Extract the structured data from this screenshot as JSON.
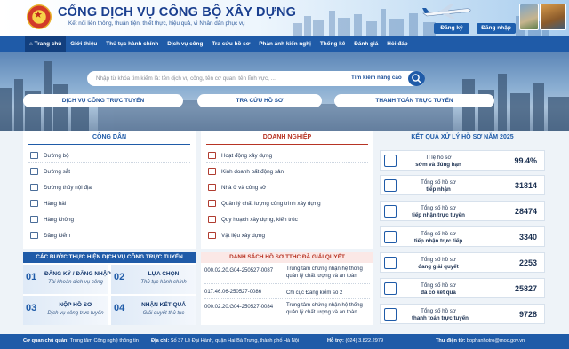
{
  "header": {
    "title": "CỔNG DỊCH VỤ CÔNG BỘ XÂY DỰNG",
    "subtitle": "Kết nối liên thông, thuận tiện, thiết thực, hiệu quả, vì Nhân dân phục vụ",
    "register_label": "Đăng ký",
    "login_label": "Đăng nhập"
  },
  "nav": [
    "Trang chủ",
    "Giới thiệu",
    "Thủ tục hành chính",
    "Dịch vụ công",
    "Tra cứu hồ sơ",
    "Phản ánh kiến nghị",
    "Thống kê",
    "Đánh giá",
    "Hỏi đáp"
  ],
  "search": {
    "placeholder": "Nhập từ khóa tìm kiếm là: tên dịch vụ công, tên cơ quan, tên lĩnh vực, ...",
    "advanced_label": "Tìm kiếm nâng cao"
  },
  "quick_links": [
    "DỊCH VỤ CÔNG TRỰC TUYẾN",
    "TRA CỨU HỒ SƠ",
    "THANH TOÁN TRỰC TUYẾN"
  ],
  "cong_dan": {
    "title": "CÔNG DÂN",
    "items": [
      "Đường bộ",
      "Đường sắt",
      "Đường thủy nội địa",
      "Hàng hải",
      "Hàng không",
      "Đăng kiểm"
    ]
  },
  "doanh_nghiep": {
    "title": "DOANH NGHIỆP",
    "items": [
      "Hoạt động xây dựng",
      "Kinh doanh bất động sản",
      "Nhà ở và công sở",
      "Quản lý chất lượng công trình xây dựng",
      "Quy hoạch xây dựng, kiến trúc",
      "Vật liệu xây dựng"
    ]
  },
  "steps": {
    "title": "CÁC BƯỚC THỰC HIỆN DỊCH VỤ CÔNG TRỰC TUYẾN",
    "items": [
      {
        "num": "01",
        "title": "ĐĂNG KÝ / ĐĂNG NHẬP",
        "sub": "Tài khoản dịch vụ công"
      },
      {
        "num": "02",
        "title": "LỰA CHỌN",
        "sub": "Thủ tục hành chính"
      },
      {
        "num": "03",
        "title": "NỘP HỒ SƠ",
        "sub": "Dịch vụ công trực tuyến"
      },
      {
        "num": "04",
        "title": "NHẬN KẾT QUẢ",
        "sub": "Giải quyết thủ tục"
      }
    ]
  },
  "resolved": {
    "title": "DANH SÁCH HỒ SƠ TTHC ĐÃ GIẢI QUYẾT",
    "rows": [
      {
        "code": "000.02.20.G04-250527-0087",
        "org": "Trung tâm chứng nhận hệ thống quản lý chất lượng và an toàn"
      },
      {
        "code": "017.46.06-250527-0086",
        "org": "Chi cục Đăng kiểm số 2"
      },
      {
        "code": "000.02.20.G04-250527-0084",
        "org": "Trung tâm chứng nhận hệ thống quản lý chất lượng và an toàn"
      }
    ]
  },
  "results": {
    "title": "KẾT QUẢ XỬ LÝ HỒ SƠ NĂM 2025",
    "items": [
      {
        "l1": "Tỉ lệ hồ sơ",
        "l2": "sớm và đúng hạn",
        "value": "99.4%"
      },
      {
        "l1": "Tổng số hồ sơ",
        "l2": "tiếp nhận",
        "value": "31814"
      },
      {
        "l1": "Tổng số hồ sơ",
        "l2": "tiếp nhận trực tuyến",
        "value": "28474"
      },
      {
        "l1": "Tổng số hồ sơ",
        "l2": "tiếp nhận trực tiếp",
        "value": "3340"
      },
      {
        "l1": "Tổng số hồ sơ",
        "l2": "đang giải quyết",
        "value": "2253"
      },
      {
        "l1": "Tổng số hồ sơ",
        "l2": "đã có kết quả",
        "value": "25827"
      },
      {
        "l1": "Tổng số hồ sơ",
        "l2": "thanh toán trực tuyến",
        "value": "9728"
      }
    ]
  },
  "footer": {
    "agency_label": "Cơ quan chủ quản:",
    "agency": "Trung tâm Công nghệ thông tin",
    "address_label": "Địa chỉ:",
    "address": "Số 37 Lê Đại Hành, quận Hai Bà Trưng, thành phố Hà Nội",
    "hotline_label": "Hỗ trợ:",
    "hotline": "(024) 3.822.2979",
    "email_label": "Thư điện tử:",
    "email": "bophanhotro@moc.gov.vn"
  },
  "colors": {
    "primary": "#1f5ba8",
    "danger": "#b73424"
  }
}
